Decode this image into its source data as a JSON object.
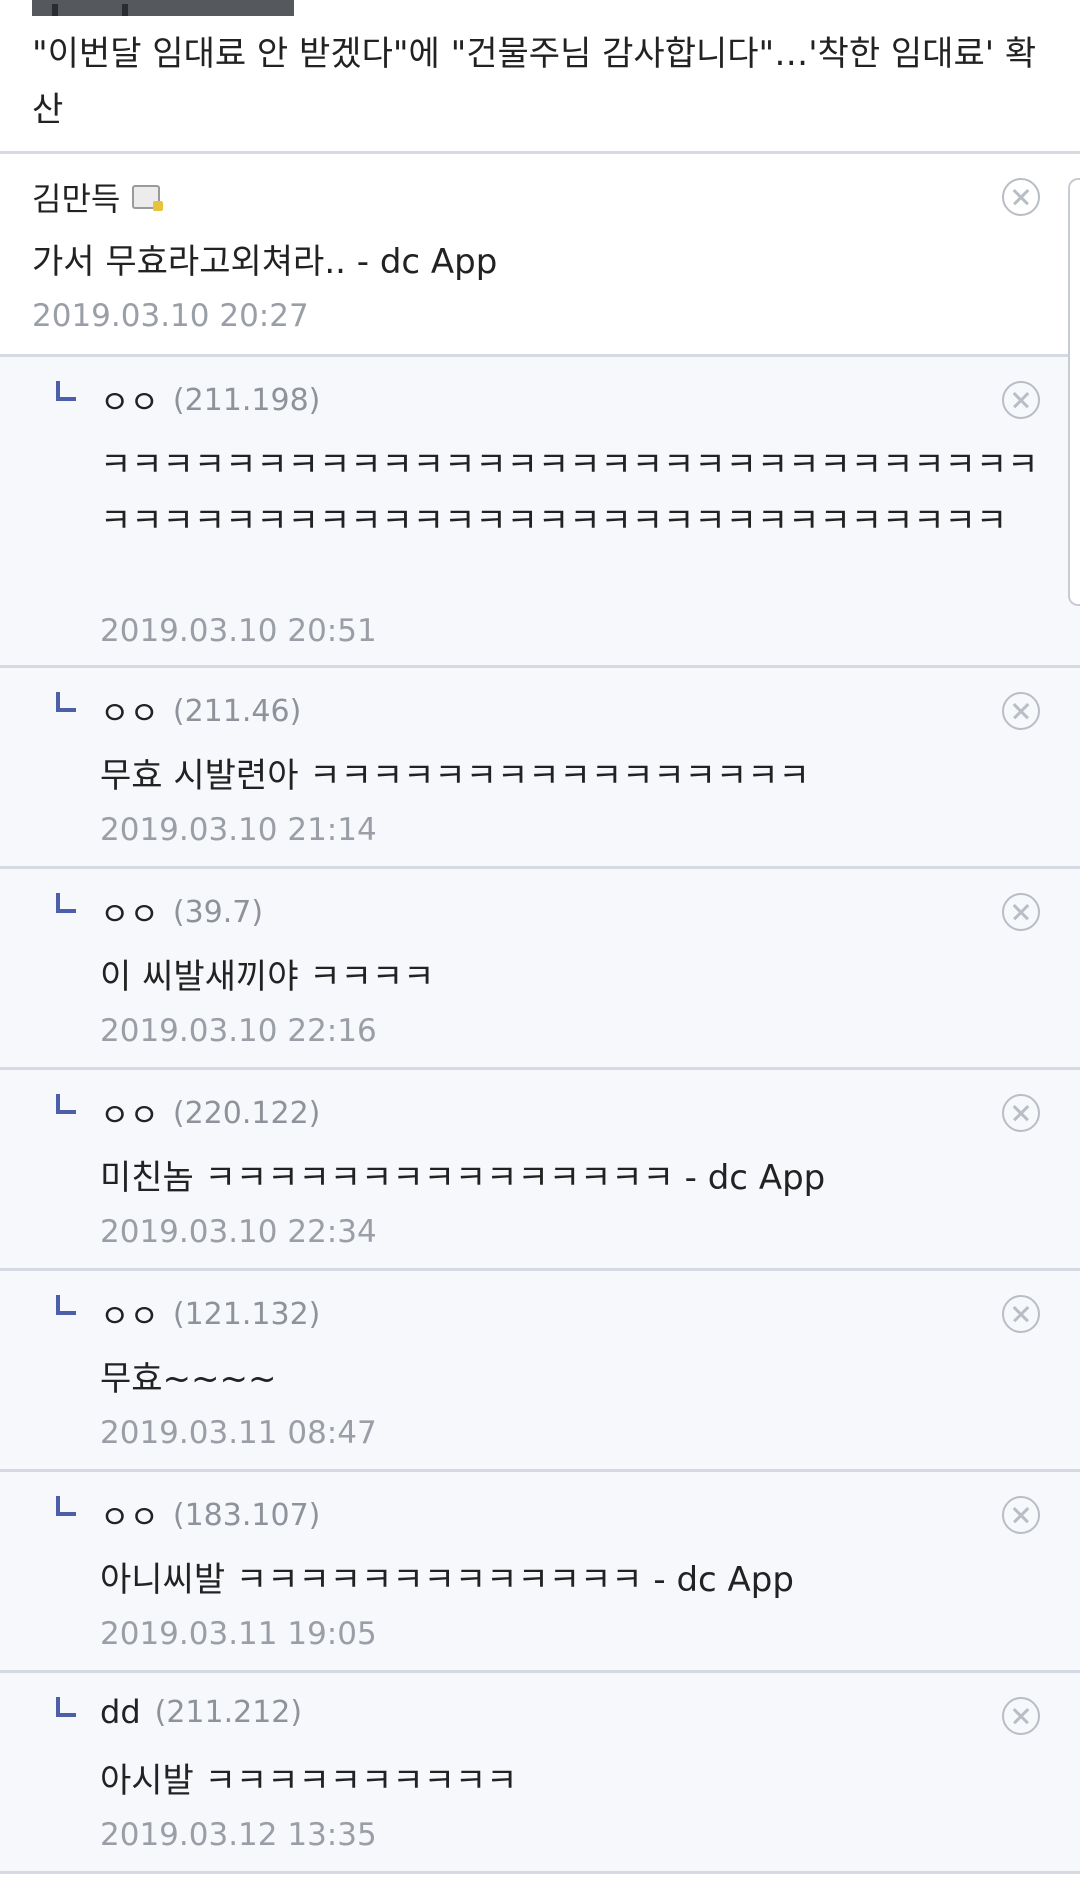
{
  "article": {
    "headline": "\"이번달 임대료 안 받겠다\"에 \"건물주님 감사합니다\"…'착한 임대료' 확산"
  },
  "comments": [
    {
      "name": "김만득",
      "ip": "",
      "badge": true,
      "body": "가서 무효라고외쳐라.. - dc App",
      "date": "2019.03.10 20:27",
      "reply": false
    },
    {
      "name": "ㅇㅇ",
      "ip": "(211.198)",
      "body": "ㅋㅋㅋㅋㅋㅋㅋㅋㅋㅋㅋㅋㅋㅋㅋㅋㅋㅋㅋㅋㅋㅋㅋㅋㅋㅋㅋㅋㅋㅋㅋㅋㅋㅋㅋㅋㅋㅋㅋㅋㅋㅋㅋㅋㅋㅋㅋㅋㅋㅋㅋㅋㅋㅋㅋㅋㅋㅋㅋ",
      "date": "2019.03.10 20:51",
      "reply": true
    },
    {
      "name": "ㅇㅇ",
      "ip": "(211.46)",
      "body": "무효 시발련아 ㅋㅋㅋㅋㅋㅋㅋㅋㅋㅋㅋㅋㅋㅋㅋㅋ",
      "date": "2019.03.10 21:14",
      "reply": true
    },
    {
      "name": "ㅇㅇ",
      "ip": "(39.7)",
      "body": "이 씨발새끼야 ㅋㅋㅋㅋ",
      "date": "2019.03.10 22:16",
      "reply": true
    },
    {
      "name": "ㅇㅇ",
      "ip": "(220.122)",
      "body": "미친놈 ㅋㅋㅋㅋㅋㅋㅋㅋㅋㅋㅋㅋㅋㅋㅋ - dc App",
      "date": "2019.03.10 22:34",
      "reply": true
    },
    {
      "name": "ㅇㅇ",
      "ip": "(121.132)",
      "body": "무효~~~~",
      "date": "2019.03.11 08:47",
      "reply": true
    },
    {
      "name": "ㅇㅇ",
      "ip": "(183.107)",
      "body": "아니씨발 ㅋㅋㅋㅋㅋㅋㅋㅋㅋㅋㅋㅋㅋ - dc App",
      "date": "2019.03.11 19:05",
      "reply": true
    },
    {
      "name": "dd",
      "ip": "(211.212)",
      "body": "아시발 ㅋㅋㅋㅋㅋㅋㅋㅋㅋㅋ",
      "date": "2019.03.12 13:35",
      "reply": true
    }
  ],
  "icons": {
    "reply": "reply-arrow-icon",
    "close": "close-circle-icon",
    "badge": "gallery-badge-icon"
  }
}
